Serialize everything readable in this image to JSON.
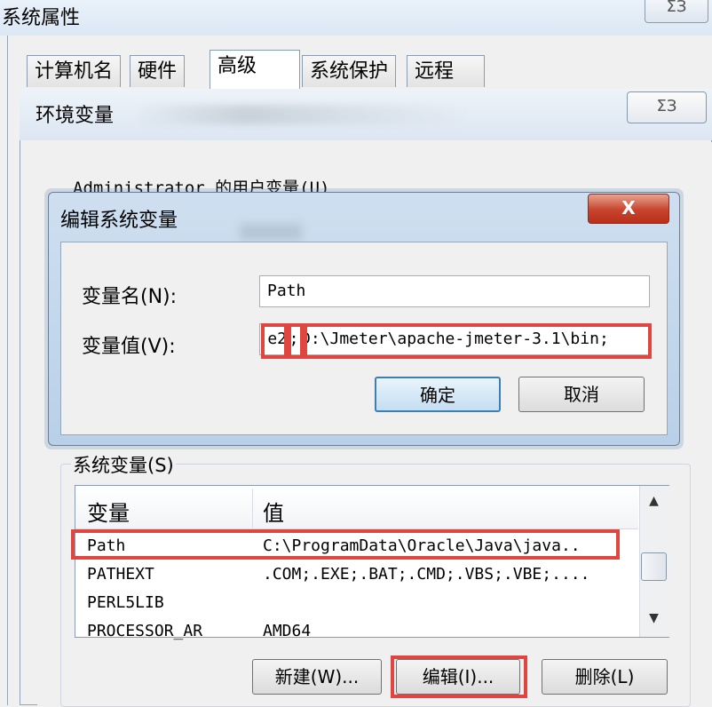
{
  "outer_window": {
    "title": "系统属性",
    "close_glyph": "ΣЗ",
    "tabs": [
      "计算机名",
      "硬件",
      "高级",
      "系统保护",
      "远程"
    ],
    "active_tab": "高级"
  },
  "env_dialog": {
    "title": "环境变量",
    "close_glyph": "ΣЗ",
    "user_group_label": "Administrator 的用户变量(U)",
    "system_group_label": "系统变量(S)",
    "system_list": {
      "headers": [
        "变量",
        "值"
      ],
      "rows": [
        {
          "name": "Path",
          "value": "C:\\ProgramData\\Oracle\\Java\\java.."
        },
        {
          "name": "PATHEXT",
          "value": ".COM;.EXE;.BAT;.CMD;.VBS;.VBE;...."
        },
        {
          "name": "PERL5LIB",
          "value": ""
        },
        {
          "name": "PROCESSOR_AR",
          "value": "AMD64"
        }
      ]
    },
    "buttons": {
      "new": "新建(W)...",
      "edit": "编辑(I)...",
      "delete": "删除(L)"
    }
  },
  "edit_dialog": {
    "title": "编辑系统变量",
    "close_glyph": "X",
    "name_label": "变量名(N):",
    "name_value": "Path",
    "value_label": "变量值(V):",
    "value_prefix": "e2",
    "value_sep": ";",
    "value_rest": "D:\\Jmeter\\apache-jmeter-3.1\\bin;",
    "ok": "确定",
    "cancel": "取消"
  },
  "colors": {
    "highlight": "#e0453f",
    "focus_button": "#3c7fb1"
  }
}
